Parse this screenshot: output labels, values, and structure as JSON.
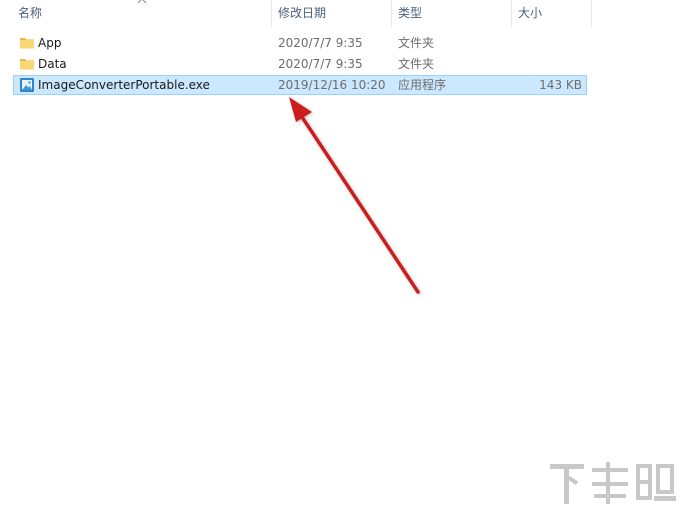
{
  "columns": {
    "name": "名称",
    "modified": "修改日期",
    "type": "类型",
    "size": "大小"
  },
  "files": [
    {
      "name": "App",
      "modified": "2020/7/7 9:35",
      "type": "文件夹",
      "size": "",
      "icon": "folder-icon",
      "selected": false
    },
    {
      "name": "Data",
      "modified": "2020/7/7 9:35",
      "type": "文件夹",
      "size": "",
      "icon": "folder-icon",
      "selected": false
    },
    {
      "name": "ImageConverterPortable.exe",
      "modified": "2019/12/16 10:20",
      "type": "应用程序",
      "size": "143 KB",
      "icon": "application-icon",
      "selected": true
    }
  ],
  "colors": {
    "selection_bg": "#cce8ff",
    "selection_border": "#99d1ff",
    "folder": "#f8d775",
    "annotation_arrow": "#cc1f1f"
  },
  "watermark_text": "下载吧"
}
